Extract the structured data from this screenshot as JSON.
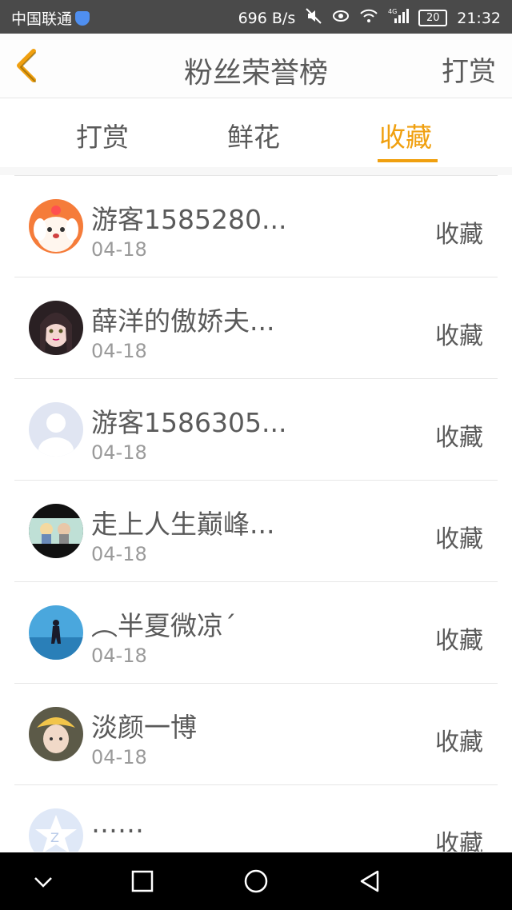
{
  "status_bar": {
    "carrier": "中国联通",
    "speed": "696 B/s",
    "network": "4G",
    "battery": "20",
    "time": "21:32"
  },
  "header": {
    "title": "粉丝荣誉榜",
    "right_action": "打赏"
  },
  "tabs": [
    {
      "label": "打赏",
      "active": false
    },
    {
      "label": "鲜花",
      "active": false
    },
    {
      "label": "收藏",
      "active": true
    }
  ],
  "list": [
    {
      "name": "游客1585280...",
      "date": "04-18",
      "action": "收藏",
      "avatar": "cartoon-dog-avatar"
    },
    {
      "name": "薛洋的傲娇夫...",
      "date": "04-18",
      "action": "收藏",
      "avatar": "anime-girl-avatar"
    },
    {
      "name": "游客1586305...",
      "date": "04-18",
      "action": "收藏",
      "avatar": "default-user-avatar"
    },
    {
      "name": "走上人生巅峰...",
      "date": "04-18",
      "action": "收藏",
      "avatar": "anime-scene-avatar"
    },
    {
      "name": "︵半夏微凉´",
      "date": "04-18",
      "action": "收藏",
      "avatar": "silhouette-sea-avatar"
    },
    {
      "name": "淡颜一博",
      "date": "04-18",
      "action": "收藏",
      "avatar": "person-hat-avatar"
    },
    {
      "name": "……",
      "date": "",
      "action": "收藏",
      "avatar": "qq-star-avatar"
    }
  ],
  "colors": {
    "accent": "#f0a010",
    "status_bar": "#4a4a4a",
    "text": "#5a5a5a",
    "subtext": "#9a9a9a"
  }
}
